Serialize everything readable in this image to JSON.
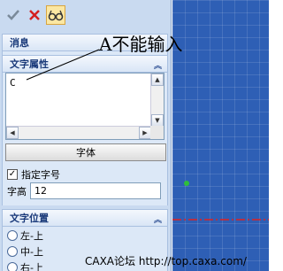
{
  "toolbar": {
    "confirm_icon": "check-icon",
    "cancel_icon": "close-icon",
    "preview_icon": "glasses-icon"
  },
  "sections": {
    "message": {
      "title": "消息"
    },
    "text_props": {
      "title": "文字属性",
      "text_value": "C",
      "font_button": "字体",
      "specify_size_label": "指定字号",
      "specify_size_checked": true,
      "height_label": "字高",
      "height_value": "12"
    },
    "text_position": {
      "title": "文字位置",
      "options": [
        "左-上",
        "中-上",
        "右-上"
      ]
    }
  },
  "annotation": {
    "text": "A不能输入"
  },
  "watermark": {
    "text": "CAXA论坛 http://top.caxa.com/"
  },
  "colors": {
    "panel": "#c9daf0",
    "canvas": "#2e5fb5",
    "accent_line": "#e02020",
    "point": "#2fbf3a"
  }
}
